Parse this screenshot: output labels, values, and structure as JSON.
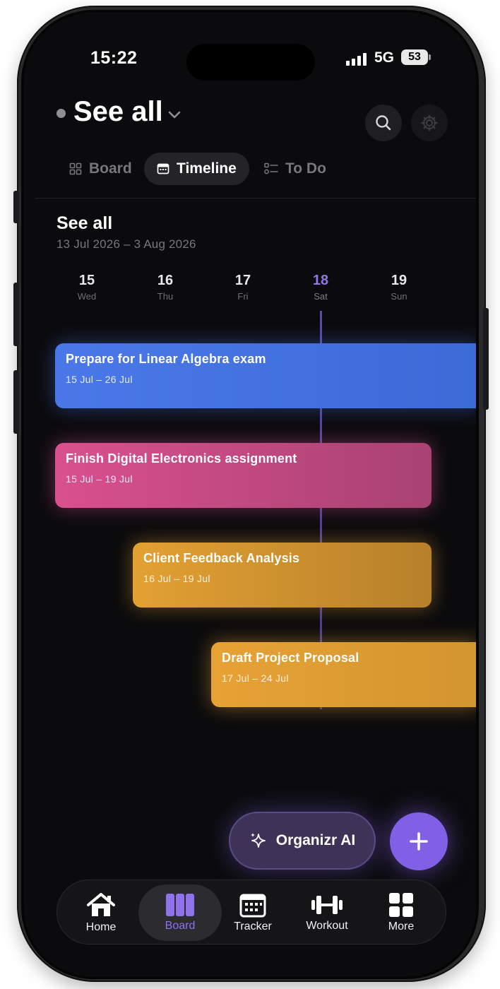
{
  "status_bar": {
    "time": "15:22",
    "network": "5G",
    "battery": "53"
  },
  "header": {
    "title": "See all"
  },
  "view_tabs": [
    {
      "label": "Board",
      "icon": "grid-icon",
      "active": false
    },
    {
      "label": "Timeline",
      "icon": "calendar-icon",
      "active": true
    },
    {
      "label": "To Do",
      "icon": "checklist-icon",
      "active": false
    }
  ],
  "timeline": {
    "title": "See all",
    "date_range": "13 Jul 2026 – 3 Aug 2026",
    "days": [
      {
        "num": "15",
        "name": "Wed"
      },
      {
        "num": "16",
        "name": "Thu"
      },
      {
        "num": "17",
        "name": "Fri"
      },
      {
        "num": "18",
        "name": "Sat",
        "today": true
      },
      {
        "num": "19",
        "name": "Sun"
      }
    ],
    "tasks": [
      {
        "title": "Prepare for Linear Algebra exam",
        "dates": "15 Jul – 26 Jul",
        "color": "#4a78e8"
      },
      {
        "title": "Finish Digital Electronics assignment",
        "dates": "15 Jul – 19 Jul",
        "color": "#d9508e"
      },
      {
        "title": "Client Feedback Analysis",
        "dates": "16 Jul – 19 Jul",
        "color": "#e3a133"
      },
      {
        "title": "Draft Project Proposal",
        "dates": "17 Jul – 24 Jul",
        "color": "#e7a235"
      }
    ]
  },
  "ai_button": {
    "label": "Organizr AI"
  },
  "bottom_nav": [
    {
      "label": "Home",
      "icon": "home-icon"
    },
    {
      "label": "Board",
      "icon": "board-icon",
      "active": true
    },
    {
      "label": "Tracker",
      "icon": "tracker-icon"
    },
    {
      "label": "Workout",
      "icon": "dumbbell-icon"
    },
    {
      "label": "More",
      "icon": "more-grid-icon"
    }
  ],
  "colors": {
    "accent": "#8160e6",
    "today": "#9077e8",
    "background": "#0b0b0d"
  }
}
